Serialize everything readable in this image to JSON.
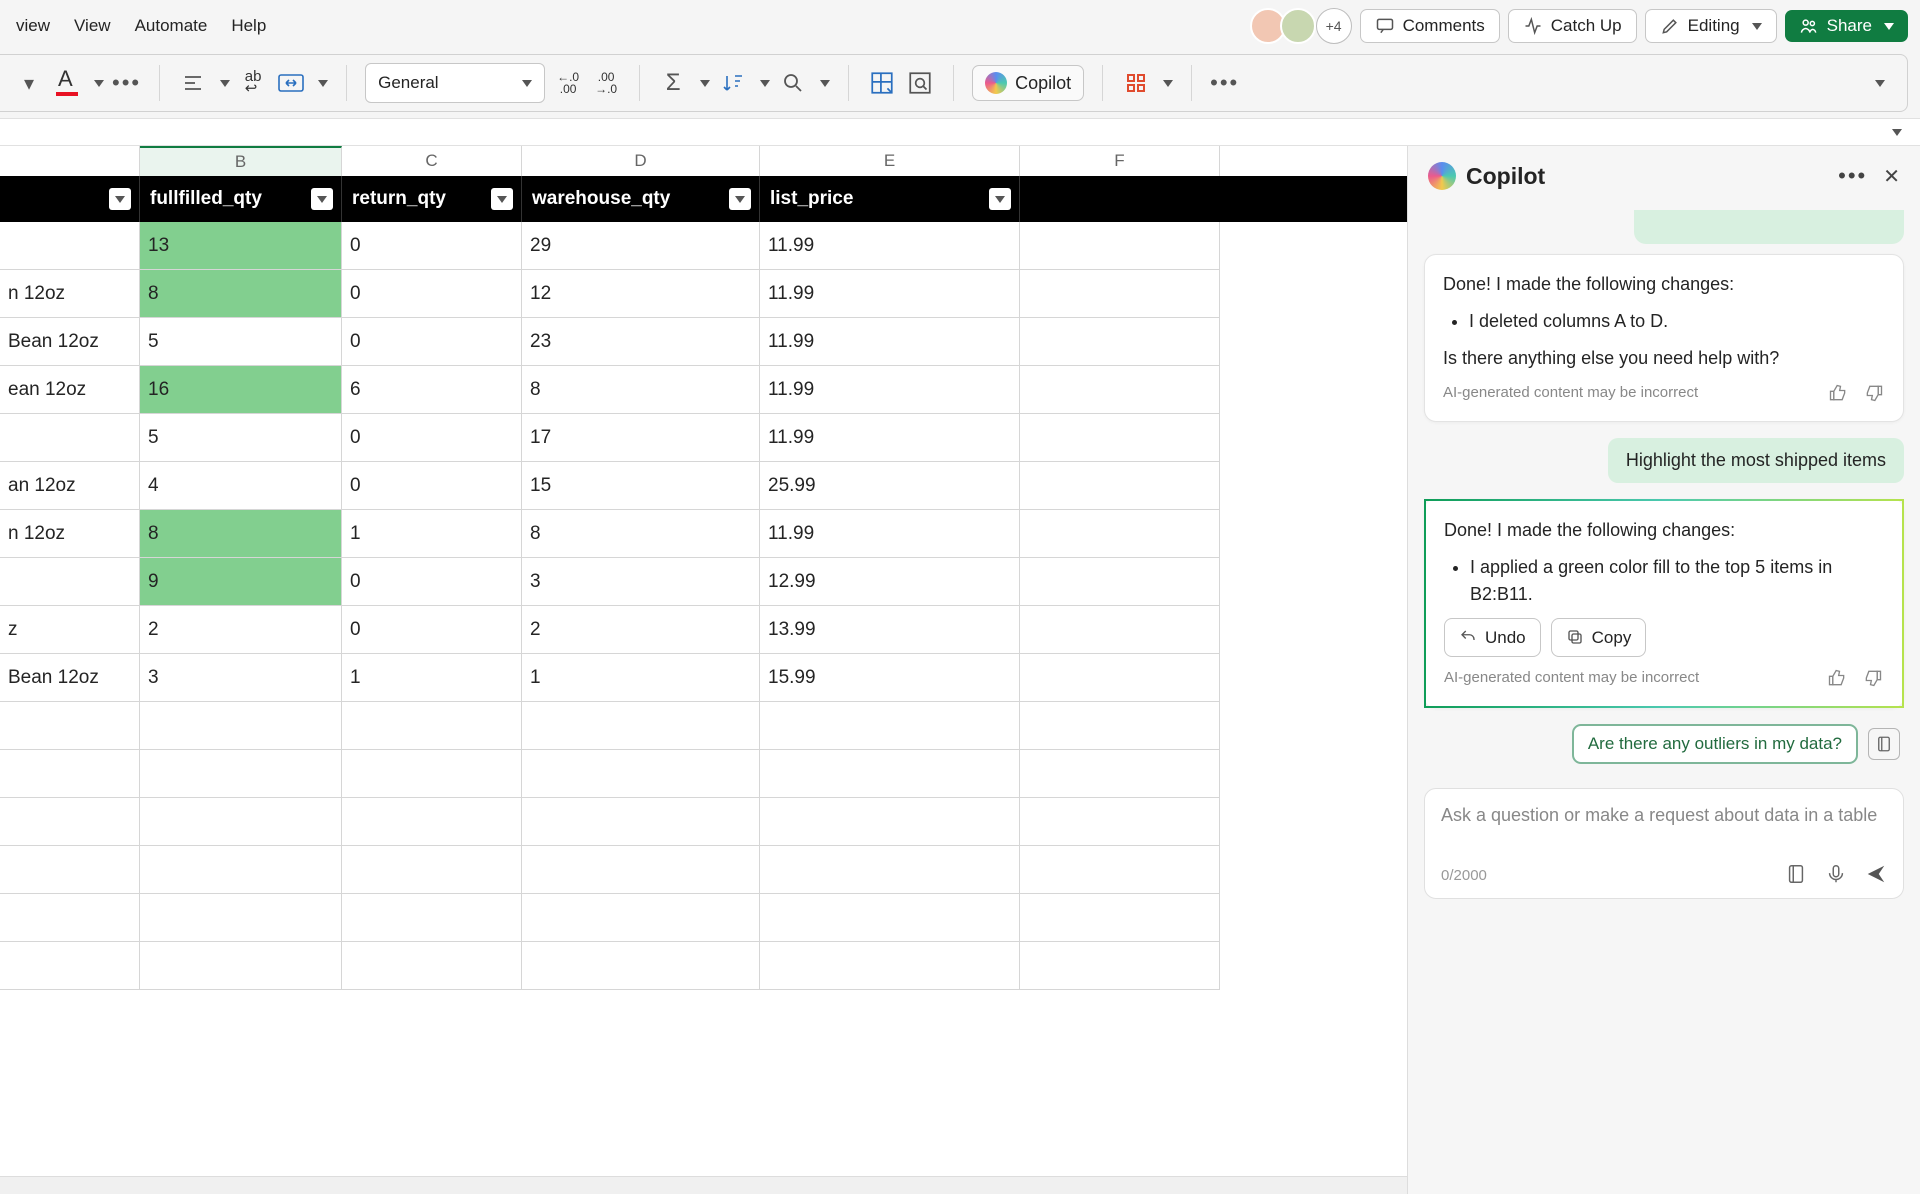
{
  "titlebar": {
    "tabs": [
      "view",
      "View",
      "Automate",
      "Help"
    ],
    "more_avatars": "+4",
    "comments": "Comments",
    "catch_up": "Catch Up",
    "editing": "Editing",
    "share": "Share"
  },
  "ribbon": {
    "number_format": "General",
    "copilot": "Copilot"
  },
  "columns": {
    "B": "B",
    "C": "C",
    "D": "D",
    "E": "E",
    "F": "F"
  },
  "table_headers": {
    "b": "fullfilled_qty",
    "c": "return_qty",
    "d": "warehouse_qty",
    "e": "list_price"
  },
  "rows": [
    {
      "a": "",
      "b": "13",
      "c": "0",
      "d": "29",
      "e": "11.99",
      "hl": true
    },
    {
      "a": "n 12oz",
      "b": "8",
      "c": "0",
      "d": "12",
      "e": "11.99",
      "hl": true
    },
    {
      "a": "Bean 12oz",
      "b": "5",
      "c": "0",
      "d": "23",
      "e": "11.99",
      "hl": false
    },
    {
      "a": "ean 12oz",
      "b": "16",
      "c": "6",
      "d": "8",
      "e": "11.99",
      "hl": true
    },
    {
      "a": "",
      "b": "5",
      "c": "0",
      "d": "17",
      "e": "11.99",
      "hl": false
    },
    {
      "a": "an 12oz",
      "b": "4",
      "c": "0",
      "d": "15",
      "e": "25.99",
      "hl": false
    },
    {
      "a": "n 12oz",
      "b": "8",
      "c": "1",
      "d": "8",
      "e": "11.99",
      "hl": true
    },
    {
      "a": "",
      "b": "9",
      "c": "0",
      "d": "3",
      "e": "12.99",
      "hl": true
    },
    {
      "a": "z",
      "b": "2",
      "c": "0",
      "d": "2",
      "e": "13.99",
      "hl": false
    },
    {
      "a": "Bean 12oz",
      "b": "3",
      "c": "1",
      "d": "1",
      "e": "15.99",
      "hl": false
    }
  ],
  "copilot": {
    "title": "Copilot",
    "msg1_lead": "Done! I made the following changes:",
    "msg1_bullet": "I deleted columns A to D.",
    "msg1_follow": "Is there anything else you need help with?",
    "disclaimer": "AI-generated content may be incorrect",
    "user_msg": "Highlight the most shipped items",
    "msg2_lead": "Done! I made the following changes:",
    "msg2_bullet": "I applied a green color fill to the top 5 items in B2:B11.",
    "undo": "Undo",
    "copy": "Copy",
    "suggest": "Are there any outliers in my data?",
    "placeholder": "Ask a question or make a request about data in a table",
    "counter": "0/2000"
  }
}
